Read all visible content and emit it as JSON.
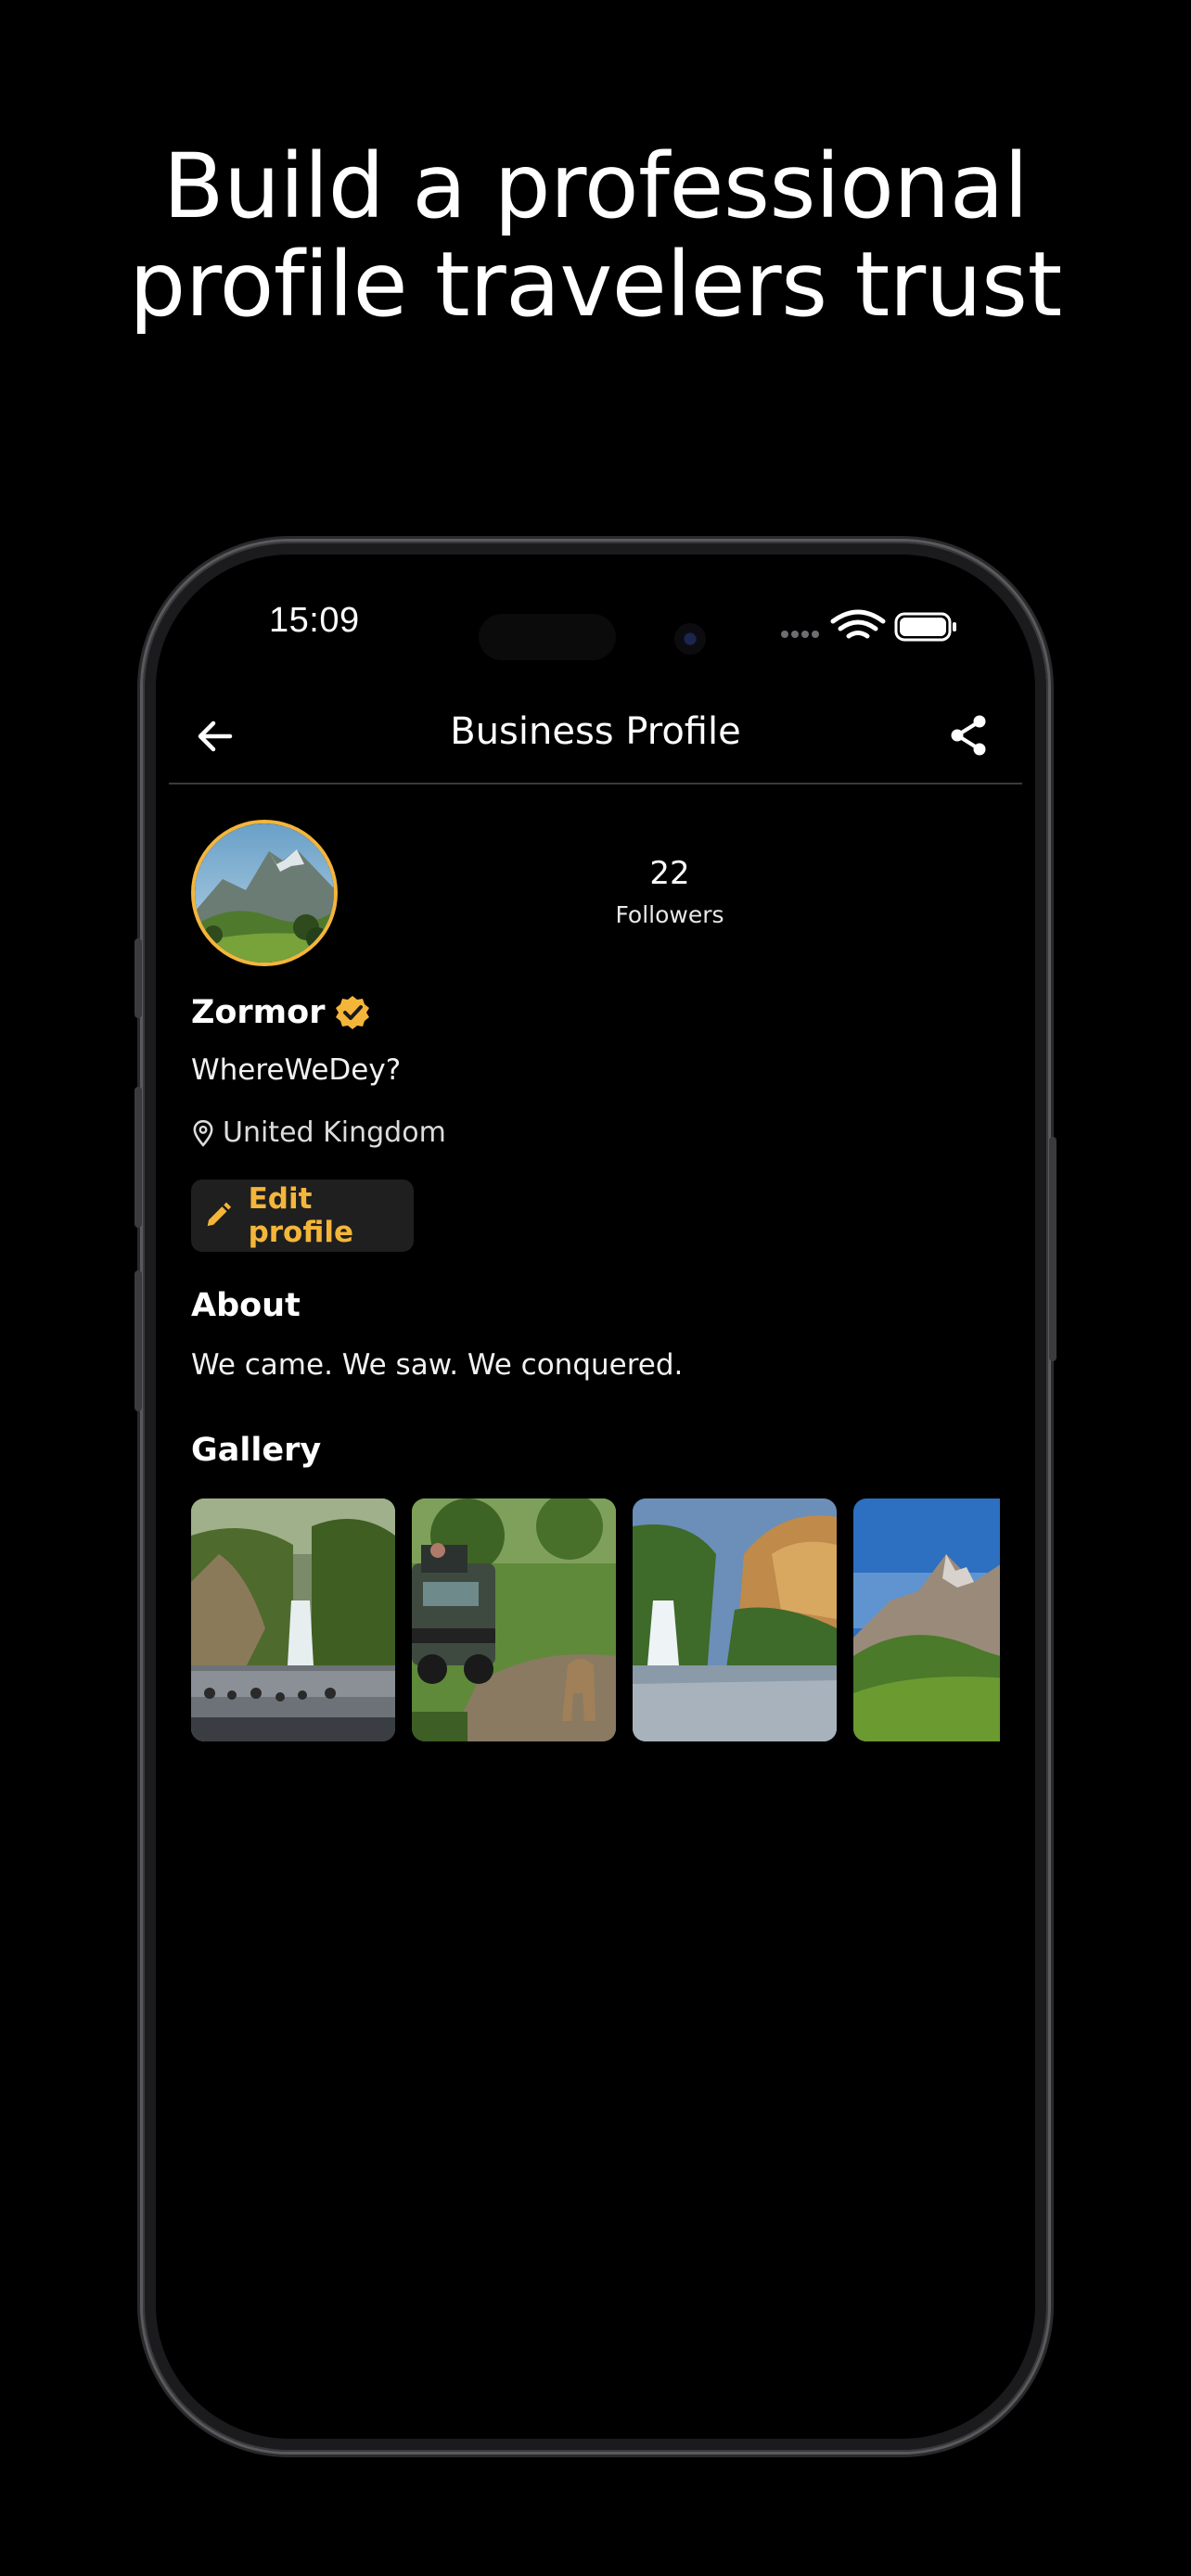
{
  "headline": {
    "line1": "Build a professional",
    "line2": "profile travelers trust"
  },
  "status_bar": {
    "time": "15:09",
    "icons": [
      "signal-dots-icon",
      "wifi-icon",
      "battery-icon"
    ]
  },
  "navbar": {
    "title": "Business Profile",
    "back_icon": "arrow-left-icon",
    "share_icon": "share-icon"
  },
  "profile": {
    "followers_count": "22",
    "followers_label": "Followers",
    "name": "Zormor",
    "verified_icon": "verified-badge-icon",
    "handle": "WhereWeDey?",
    "location_icon": "location-pin-icon",
    "location": "United Kingdom",
    "edit_icon": "pencil-icon",
    "edit_label": "Edit profile"
  },
  "about": {
    "title": "About",
    "text": "We came. We saw. We conquered."
  },
  "gallery": {
    "title": "Gallery",
    "items": [
      "waterfall-river-photo",
      "safari-vehicle-lion-photo",
      "waterfall-gorge-photo",
      "mountain-valley-photo"
    ]
  },
  "colors": {
    "background": "#000000",
    "accent": "#f4b63a",
    "button_bg": "#1f1f1f",
    "divider": "#3a3a3c"
  }
}
